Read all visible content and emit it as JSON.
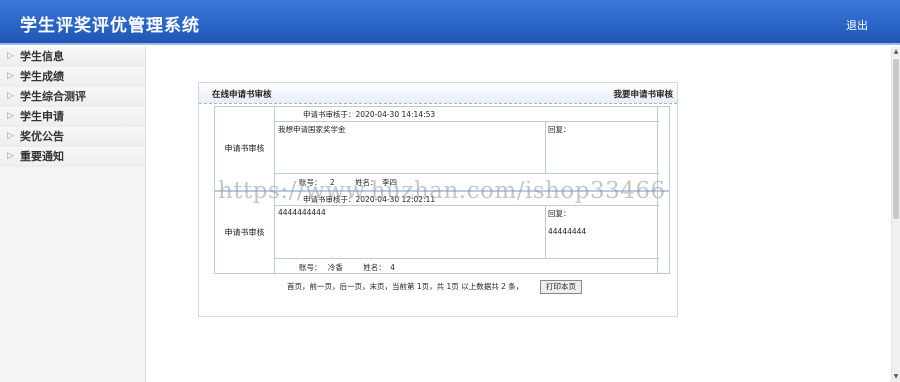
{
  "header": {
    "title": "学生评奖评优管理系统",
    "logout": "退出"
  },
  "sidebar": {
    "items": [
      {
        "label": "学生信息"
      },
      {
        "label": "学生成绩"
      },
      {
        "label": "学生综合测评"
      },
      {
        "label": "学生申请"
      },
      {
        "label": "奖优公告"
      },
      {
        "label": "重要通知"
      }
    ]
  },
  "panel": {
    "title": "在线申请书审核",
    "link": "我要申请书审核",
    "records": [
      {
        "label": "申请书审核",
        "time": "申请书审核于：2020-04-30 14:14:53",
        "content": "我想申请国家奖学金",
        "reply_label": "回复：",
        "reply_value": "",
        "account_label": "账号：",
        "account_value": "2",
        "name_label": "姓名：",
        "name_value": "李四"
      },
      {
        "label": "申请书审核",
        "time": "申请书审核于：2020-04-30 12:02:11",
        "content": "4444444444",
        "reply_label": "回复：",
        "reply_value": "44444444",
        "account_label": "账号：",
        "account_value": "冷香",
        "name_label": "姓名：",
        "name_value": "4"
      }
    ]
  },
  "pager": {
    "text": "首页，前一页，后一页，末页，当前第 1页，共 1页 以上数据共 2 条，",
    "print_label": "打印本页"
  },
  "watermark": "https://www.huzhan.com/ishop33466"
}
